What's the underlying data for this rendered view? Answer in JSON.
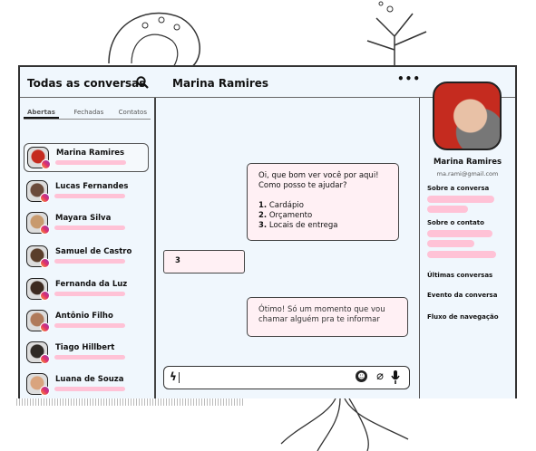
{
  "header": {
    "left_title": "Todas as conversas",
    "chat_title": "Marina Ramires",
    "more_icon": "more-horizontal-icon",
    "search_icon": "search-icon"
  },
  "tabs": [
    {
      "label": "Abertas",
      "active": true
    },
    {
      "label": "Fechadas"
    },
    {
      "label": "Contatos"
    }
  ],
  "contacts": [
    {
      "name": "Marina Ramires",
      "color": "#c52b1f"
    },
    {
      "name": "Lucas Fernandes",
      "color": "#6b4a3a"
    },
    {
      "name": "Mayara Silva",
      "color": "#c89a6e"
    },
    {
      "name": "Samuel de Castro",
      "color": "#5a3e2b"
    },
    {
      "name": "Fernanda da Luz",
      "color": "#3d2a20"
    },
    {
      "name": "Antônio Filho",
      "color": "#b07a5a"
    },
    {
      "name": "Tiago Hillbert",
      "color": "#2f2a26"
    },
    {
      "name": "Luana de Souza",
      "color": "#d9a47e"
    }
  ],
  "messages": {
    "m1_line1": "Oi, que bom ver você por aqui!",
    "m1_line2": "Como posso te ajudar?",
    "opt1_n": "1.",
    "opt1": "Cardápio",
    "opt2_n": "2.",
    "opt2": "Orçamento",
    "opt3_n": "3.",
    "opt3": "Locais de entrega",
    "reply": "3",
    "m2_line1": "Ótimo! Só um momento que vou",
    "m2_line2": "chamar alguém pra te informar"
  },
  "input": {
    "icons": [
      "lightning-icon",
      "emoji-icon",
      "paperclip-icon",
      "microphone-icon"
    ]
  },
  "profile": {
    "name": "Marina Ramires",
    "email": "ma.rami@gmail.com",
    "about_conversation": "Sobre a conversa",
    "about_contact": "Sobre o contato",
    "links": [
      "Últimas conversas",
      "Evento da conversa",
      "Fluxo de navegação"
    ]
  }
}
